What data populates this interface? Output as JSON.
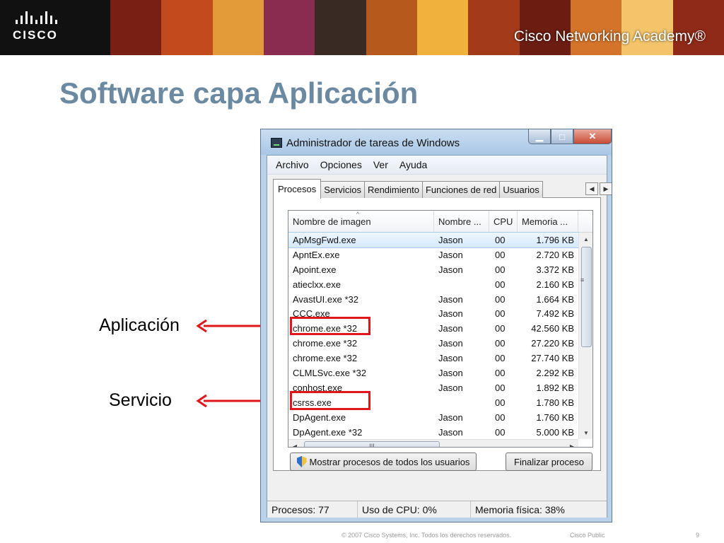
{
  "banner": {
    "logo_text": "CISCO",
    "academy": "Cisco Networking Academy®",
    "photo_colors": [
      "#7a1f14",
      "#c24a1c",
      "#e39b3a",
      "#8a2b50",
      "#3a2a24",
      "#b55a1c",
      "#f0b23d",
      "#a33b1a",
      "#6b1d12",
      "#d4742a",
      "#f3c46a",
      "#902a18"
    ]
  },
  "slide": {
    "title": "Software capa Aplicación",
    "annotation_app": "Aplicación",
    "annotation_service": "Servicio"
  },
  "window": {
    "title": "Administrador de tareas de Windows",
    "btn_min": "▁",
    "btn_max": "□",
    "btn_close": "✕",
    "menu": [
      "Archivo",
      "Opciones",
      "Ver",
      "Ayuda"
    ],
    "tabs": [
      "Procesos",
      "Servicios",
      "Rendimiento",
      "Funciones de red",
      "Usuarios"
    ],
    "tab_scroll_left": "◀",
    "tab_scroll_right": "▶",
    "columns": [
      "Nombre de imagen",
      "Nombre ...",
      "CPU",
      "Memoria ..."
    ],
    "sort_indicator": "^",
    "rows": [
      {
        "name": "ApMsgFwd.exe",
        "user": "Jason",
        "cpu": "00",
        "mem": "1.796 KB"
      },
      {
        "name": "ApntEx.exe",
        "user": "Jason",
        "cpu": "00",
        "mem": "2.720 KB"
      },
      {
        "name": "Apoint.exe",
        "user": "Jason",
        "cpu": "00",
        "mem": "3.372 KB"
      },
      {
        "name": "atieclxx.exe",
        "user": "",
        "cpu": "00",
        "mem": "2.160 KB"
      },
      {
        "name": "AvastUI.exe *32",
        "user": "Jason",
        "cpu": "00",
        "mem": "1.664 KB"
      },
      {
        "name": "CCC.exe",
        "user": "Jason",
        "cpu": "00",
        "mem": "7.492 KB"
      },
      {
        "name": "chrome.exe *32",
        "user": "Jason",
        "cpu": "00",
        "mem": "42.560 KB"
      },
      {
        "name": "chrome.exe *32",
        "user": "Jason",
        "cpu": "00",
        "mem": "27.220 KB"
      },
      {
        "name": "chrome.exe *32",
        "user": "Jason",
        "cpu": "00",
        "mem": "27.740 KB"
      },
      {
        "name": "CLMLSvc.exe *32",
        "user": "Jason",
        "cpu": "00",
        "mem": "2.292 KB"
      },
      {
        "name": "conhost.exe",
        "user": "Jason",
        "cpu": "00",
        "mem": "1.892 KB"
      },
      {
        "name": "csrss.exe",
        "user": "",
        "cpu": "00",
        "mem": "1.780 KB"
      },
      {
        "name": "DpAgent.exe",
        "user": "Jason",
        "cpu": "00",
        "mem": "1.760 KB"
      },
      {
        "name": "DpAgent.exe *32",
        "user": "Jason",
        "cpu": "00",
        "mem": "5.000 KB"
      }
    ],
    "scroll_up": "▲",
    "scroll_down": "▼",
    "scroll_left": "◀",
    "scroll_right": "▶",
    "vgrip": "≡",
    "hgrip": "III",
    "show_all_button": "Mostrar procesos de todos los usuarios",
    "end_process_button": "Finalizar proceso",
    "status": {
      "processes": "Procesos: 77",
      "cpu": "Uso de CPU: 0%",
      "memory": "Memoria física: 38%"
    }
  },
  "footer": {
    "copyright": "© 2007 Cisco Systems, Inc. Todos los derechos reservados.",
    "classification": "Cisco Public",
    "page": "9"
  }
}
